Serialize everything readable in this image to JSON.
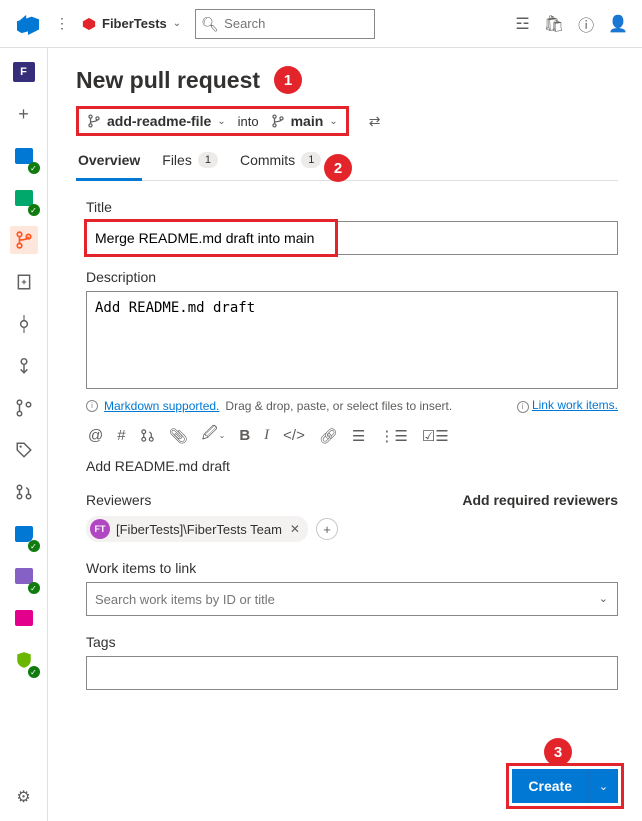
{
  "header": {
    "project_name": "FiberTests",
    "search_placeholder": "Search"
  },
  "page": {
    "title": "New pull request",
    "source_branch": "add-readme-file",
    "into_label": "into",
    "target_branch": "main"
  },
  "tabs": {
    "overview": "Overview",
    "files": "Files",
    "files_count": "1",
    "commits": "Commits",
    "commits_count": "1"
  },
  "form": {
    "title_label": "Title",
    "title_value": "Merge README.md draft into main",
    "description_label": "Description",
    "description_value": "Add README.md draft",
    "markdown_hint": "Markdown supported.",
    "dragdrop_hint": " Drag & drop, paste, or select files to insert.",
    "link_work_items": "Link work items.",
    "preview_text": "Add README.md draft",
    "reviewers_label": "Reviewers",
    "add_required_label": "Add required reviewers",
    "reviewer_chip": "[FiberTests]\\FiberTests Team",
    "reviewer_avatar": "FT",
    "work_items_label": "Work items to link",
    "work_items_placeholder": "Search work items by ID or title",
    "tags_label": "Tags",
    "create_label": "Create"
  },
  "callouts": {
    "one": "1",
    "two": "2",
    "three": "3"
  }
}
